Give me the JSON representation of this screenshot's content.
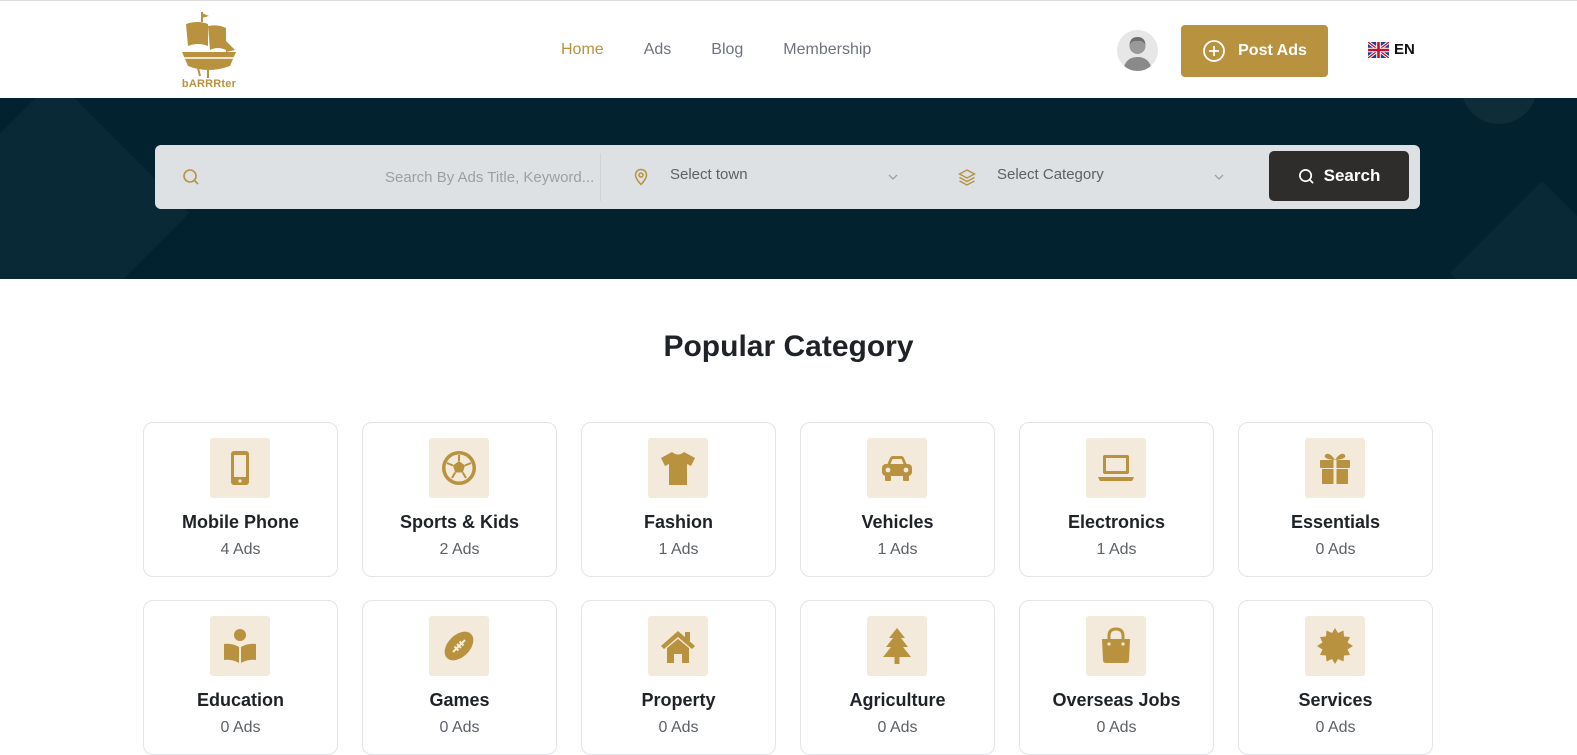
{
  "brand": {
    "name": "bARRRter",
    "color": "#b8923f"
  },
  "nav": {
    "items": [
      {
        "label": "Home",
        "active": true
      },
      {
        "label": "Ads"
      },
      {
        "label": "Blog"
      },
      {
        "label": "Membership"
      }
    ]
  },
  "header": {
    "post_ads_label": "Post Ads",
    "language": "EN"
  },
  "search": {
    "keyword_placeholder": "Search By Ads Title, Keyword...",
    "town_placeholder": "Select town",
    "category_placeholder": "Select Category",
    "button_label": "Search"
  },
  "popular": {
    "title": "Popular Category",
    "categories": [
      {
        "name": "Mobile Phone",
        "count": "4 Ads",
        "icon": "mobile-phone-icon"
      },
      {
        "name": "Sports & Kids",
        "count": "2 Ads",
        "icon": "soccer-ball-icon"
      },
      {
        "name": "Fashion",
        "count": "1 Ads",
        "icon": "t-shirt-icon"
      },
      {
        "name": "Vehicles",
        "count": "1 Ads",
        "icon": "car-icon"
      },
      {
        "name": "Electronics",
        "count": "1 Ads",
        "icon": "laptop-icon"
      },
      {
        "name": "Essentials",
        "count": "0 Ads",
        "icon": "gift-icon"
      },
      {
        "name": "Education",
        "count": "0 Ads",
        "icon": "book-reader-icon"
      },
      {
        "name": "Games",
        "count": "0 Ads",
        "icon": "football-icon"
      },
      {
        "name": "Property",
        "count": "0 Ads",
        "icon": "house-icon"
      },
      {
        "name": "Agriculture",
        "count": "0 Ads",
        "icon": "tree-icon"
      },
      {
        "name": "Overseas Jobs",
        "count": "0 Ads",
        "icon": "shopping-bag-icon"
      },
      {
        "name": "Services",
        "count": "0 Ads",
        "icon": "badge-icon"
      }
    ]
  }
}
